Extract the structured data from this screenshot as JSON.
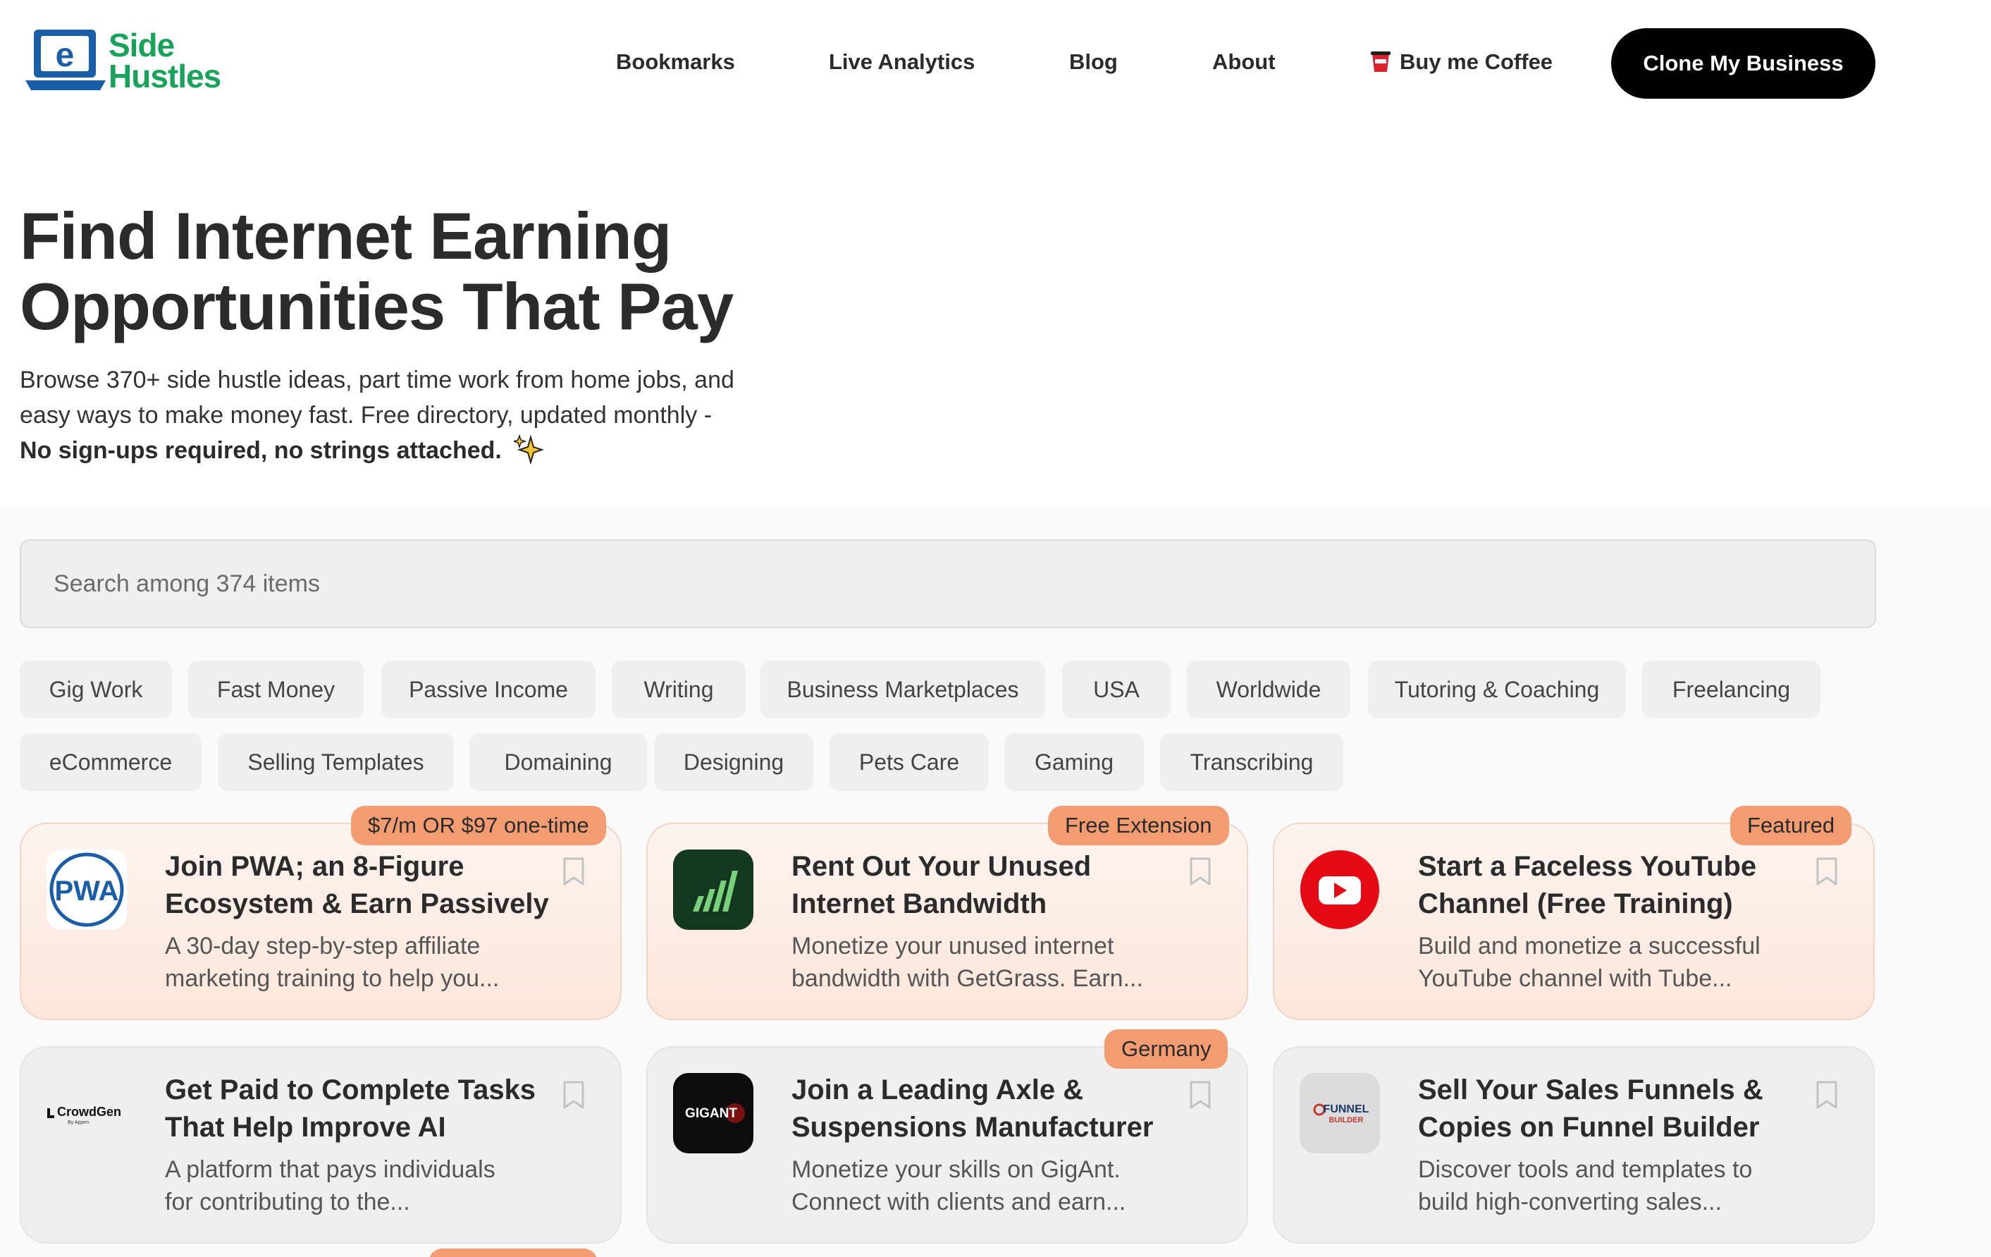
{
  "brand": {
    "logo_letter": "e",
    "logo_line1": "Side",
    "logo_line2": "Hustles",
    "accent": "#19a35a",
    "logo_blue": "#1b5ea8"
  },
  "nav": {
    "items": [
      "Bookmarks",
      "Live Analytics",
      "Blog",
      "About"
    ],
    "coffee": "Buy me Coffee",
    "cta": "Clone My Business"
  },
  "hero": {
    "title_line1": "Find Internet Earning",
    "title_line2": "Opportunities That Pay",
    "subtitle_line1": "Browse 370+ side hustle ideas, part time work from home jobs, and",
    "subtitle_line2": "easy ways to make money fast. Free directory, updated monthly -",
    "subtitle_strong": "No sign-ups required, no strings attached."
  },
  "search": {
    "placeholder": "Search among 374 items"
  },
  "filters": {
    "row1": [
      "Gig Work",
      "Fast Money",
      "Passive Income",
      "Writing",
      "Business Marketplaces",
      "USA",
      "Worldwide",
      "Tutoring & Coaching",
      "Freelancing"
    ],
    "row2": [
      "eCommerce",
      "Selling Templates",
      "Domaining",
      "Designing",
      "Pets Care",
      "Gaming",
      "Transcribing"
    ]
  },
  "cards": [
    {
      "badge": "$7/m OR $97 one-time",
      "logo_text": "PWA",
      "title": "Join PWA; an 8-Figure Ecosystem & Earn Passively",
      "desc_line1": "A 30-day step-by-step affiliate",
      "desc_line2": "marketing training to help you..."
    },
    {
      "badge": "Free Extension",
      "logo_text": "",
      "title": "Rent Out Your Unused Internet Bandwidth",
      "desc_line1": "Monetize your unused internet",
      "desc_line2": "bandwidth with GetGrass. Earn..."
    },
    {
      "badge": "Featured",
      "logo_text": "",
      "title": "Start a Faceless YouTube Channel (Free Training)",
      "desc_line1": "Build and monetize a successful",
      "desc_line2": "YouTube channel with Tube..."
    },
    {
      "badge": "",
      "logo_text": "CrowdGen",
      "logo_sub": "By Appen",
      "title": "Get Paid to Complete Tasks That Help Improve AI",
      "desc_line1": "A platform that pays individuals",
      "desc_line2": "for contributing to the..."
    },
    {
      "badge": "Germany",
      "logo_text": "GIGANT",
      "title": "Join a Leading Axle & Suspensions Manufacturer",
      "desc_line1": "Monetize your skills on GigAnt.",
      "desc_line2": "Connect with clients and earn..."
    },
    {
      "badge": "",
      "logo_text": "FUNNEL",
      "logo_sub": "BUILDER",
      "title": "Sell Your Sales Funnels & Copies on Funnel Builder",
      "desc_line1": "Discover tools and templates to",
      "desc_line2": "build high-converting sales..."
    }
  ]
}
